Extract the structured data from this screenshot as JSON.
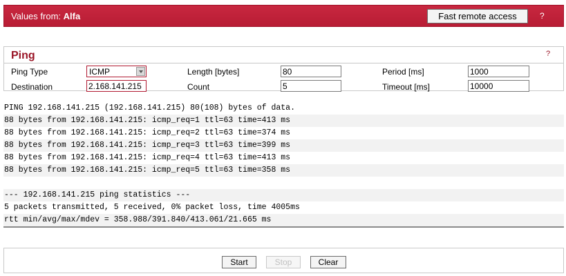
{
  "header": {
    "title_prefix": "Values from:",
    "device_name": "Alfa",
    "fast_remote_access_label": "Fast remote access",
    "help": "?"
  },
  "ping": {
    "title": "Ping",
    "help": "?",
    "ping_type_label": "Ping Type",
    "ping_type_value": "ICMP",
    "destination_label": "Destination",
    "destination_value": "2.168.141.215",
    "length_label": "Length [bytes]",
    "length_value": "80",
    "count_label": "Count",
    "count_value": "5",
    "period_label": "Period [ms]",
    "period_value": "1000",
    "timeout_label": "Timeout [ms]",
    "timeout_value": "10000"
  },
  "output": {
    "lines": [
      "PING 192.168.141.215 (192.168.141.215) 80(108) bytes of data.",
      "88 bytes from 192.168.141.215: icmp_req=1 ttl=63 time=413 ms",
      "88 bytes from 192.168.141.215: icmp_req=2 ttl=63 time=374 ms",
      "88 bytes from 192.168.141.215: icmp_req=3 ttl=63 time=399 ms",
      "88 bytes from 192.168.141.215: icmp_req=4 ttl=63 time=413 ms",
      "88 bytes from 192.168.141.215: icmp_req=5 ttl=63 time=358 ms",
      "",
      "--- 192.168.141.215 ping statistics ---",
      "5 packets transmitted, 5 received, 0% packet loss, time 4005ms",
      "rtt min/avg/max/mdev = 358.988/391.840/413.061/21.665 ms"
    ]
  },
  "footer": {
    "start_label": "Start",
    "stop_label": "Stop",
    "clear_label": "Clear"
  }
}
